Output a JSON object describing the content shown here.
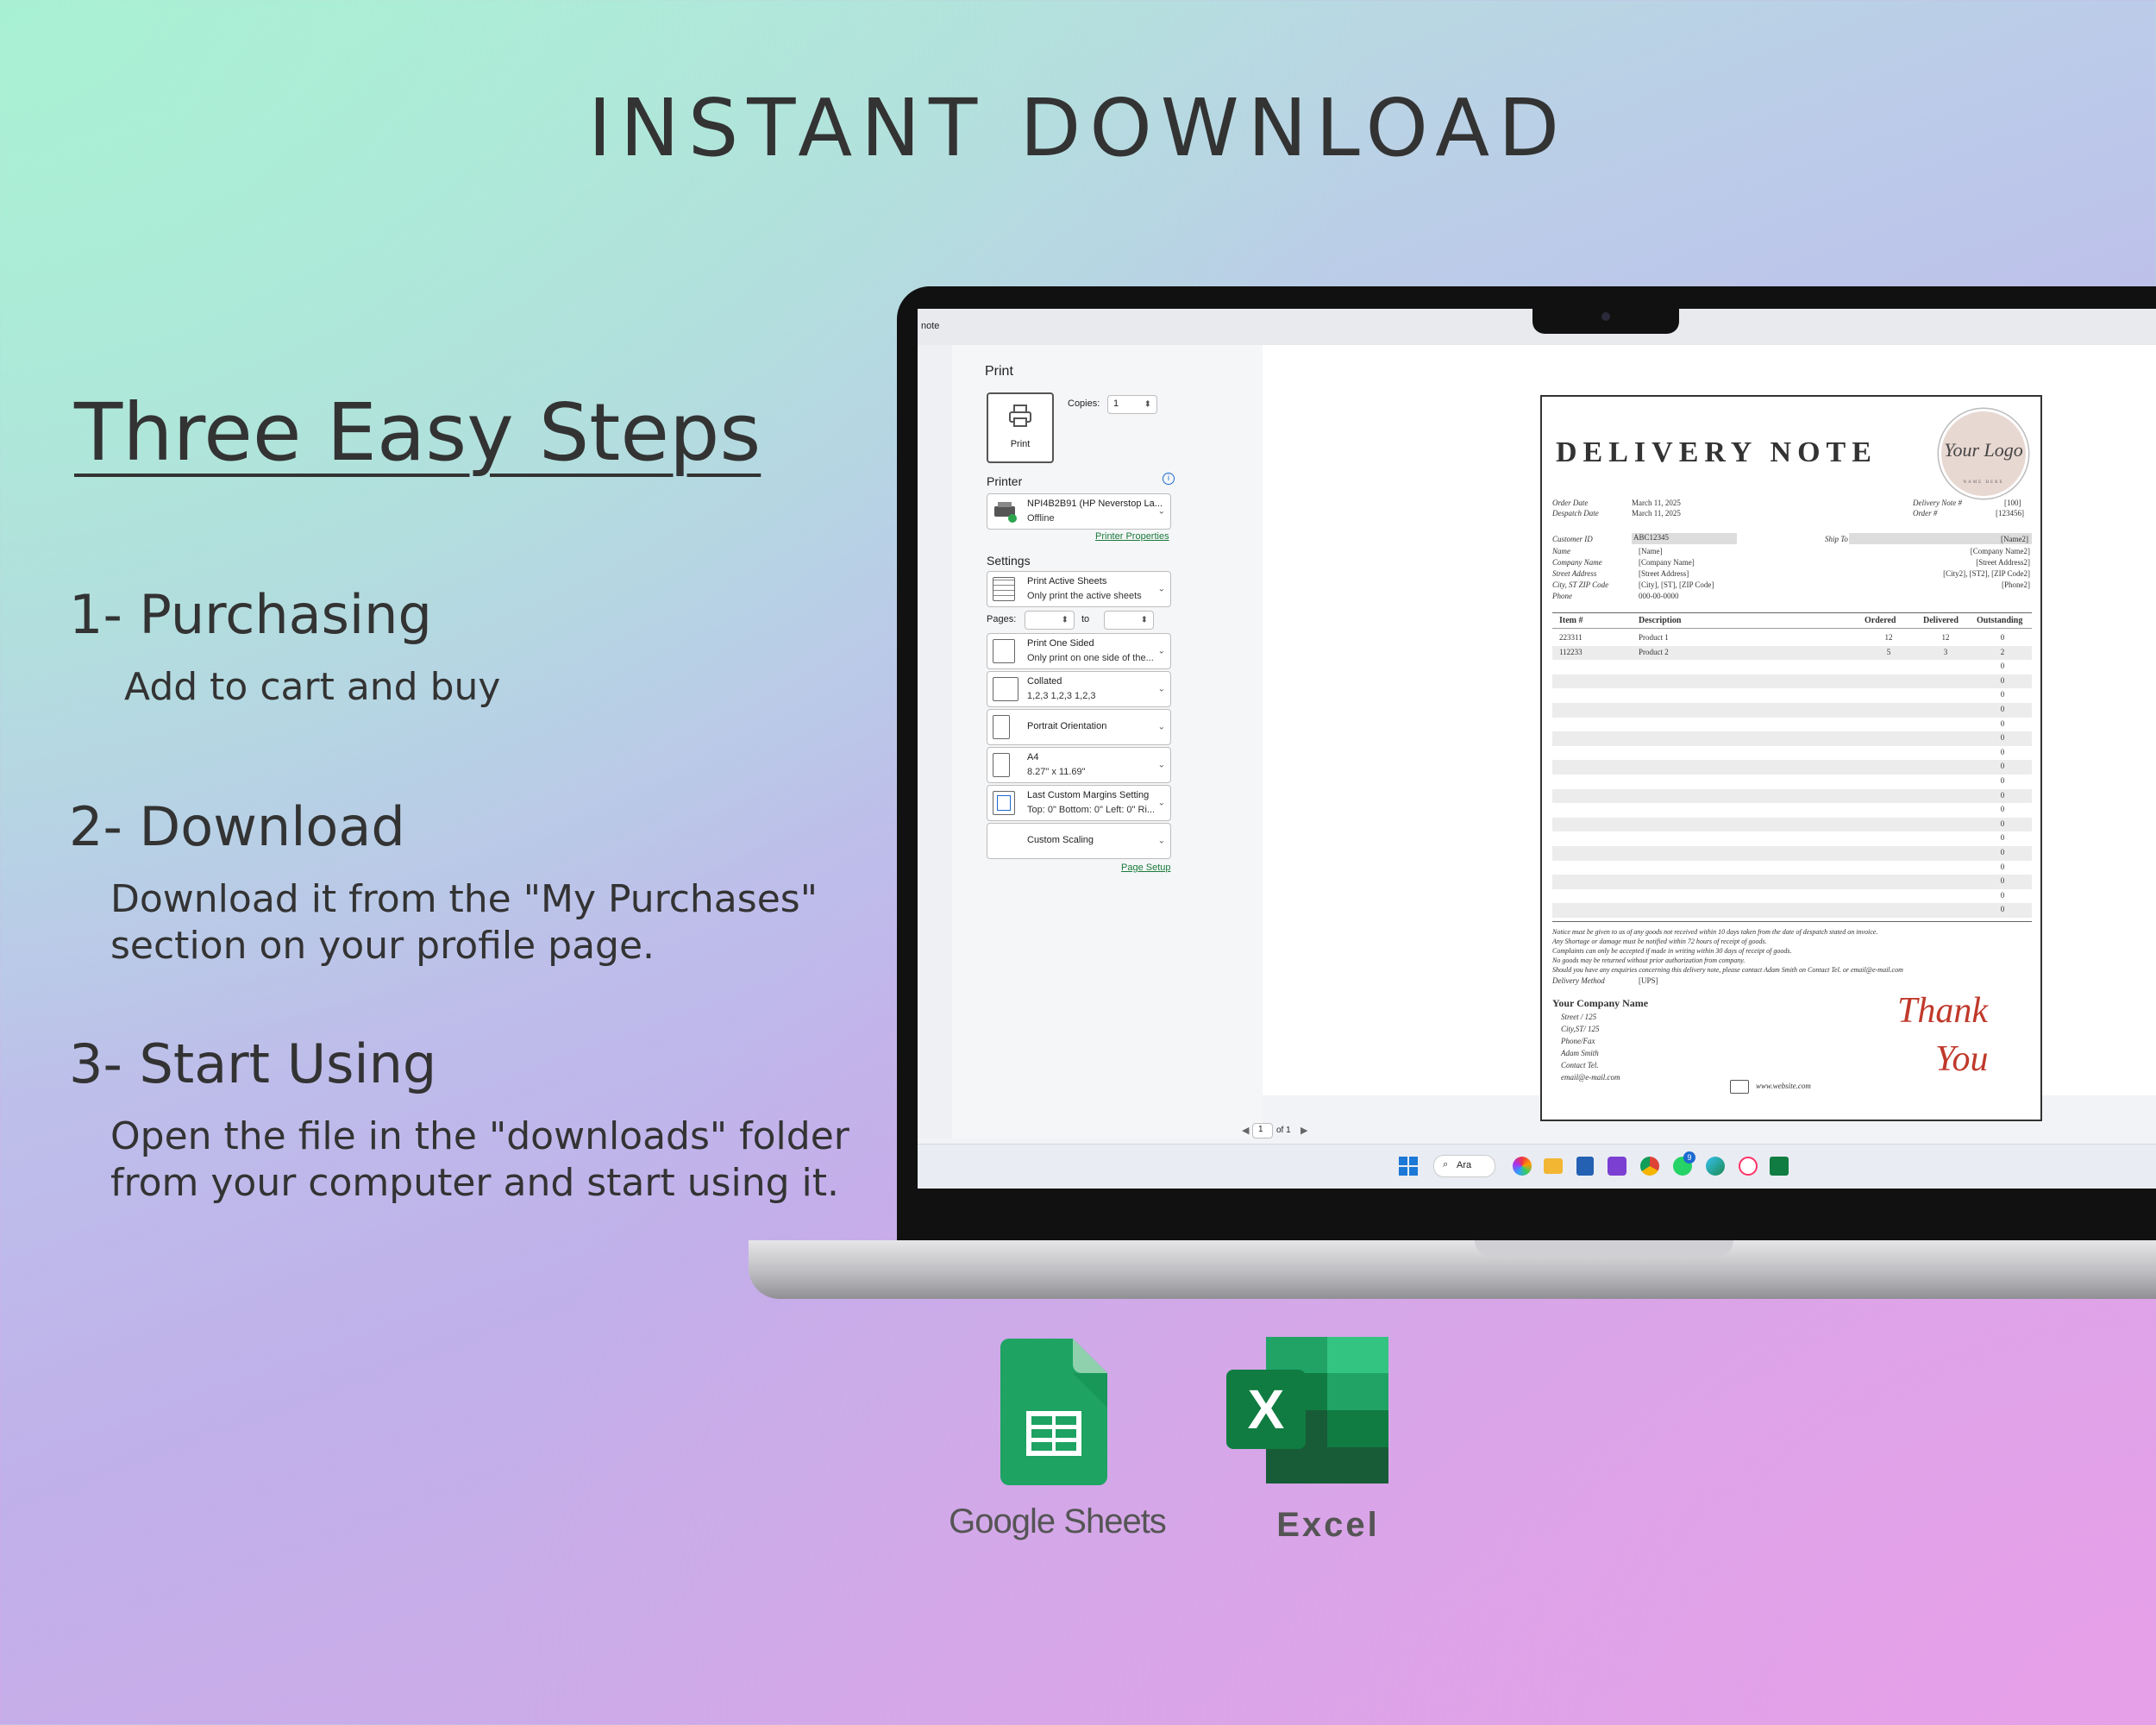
{
  "headline": "INSTANT DOWNLOAD",
  "steps": {
    "title": "Three Easy Steps",
    "items": [
      {
        "heading": "1- Purchasing",
        "lines": [
          "Add to cart and buy"
        ]
      },
      {
        "heading": "2- Download",
        "lines": [
          "Download it from the \"My Purchases\"",
          "section on your profile page."
        ]
      },
      {
        "heading": "3- Start Using",
        "lines": [
          "Open the file in the \"downloads\" folder",
          "from your computer and start using it."
        ]
      }
    ]
  },
  "print_dialog": {
    "window_title": "note",
    "title": "Print",
    "print_button": "Print",
    "copies_label": "Copies:",
    "copies_value": "1",
    "printer_label": "Printer",
    "printer_name": "NPI4B2B91 (HP Neverstop La...",
    "printer_status": "Offline",
    "printer_properties": "Printer Properties",
    "settings_label": "Settings",
    "settings": [
      {
        "line1": "Print Active Sheets",
        "line2": "Only print the active sheets"
      },
      {
        "line1": "Print One Sided",
        "line2": "Only print on one side of the..."
      },
      {
        "line1": "Collated",
        "line2": "1,2,3    1,2,3    1,2,3"
      },
      {
        "line1": "Portrait Orientation",
        "line2": ""
      },
      {
        "line1": "A4",
        "line2": "8.27\" x 11.69\""
      },
      {
        "line1": "Last Custom Margins Setting",
        "line2": "Top: 0\" Bottom: 0\" Left: 0\" Ri..."
      },
      {
        "line1": "Custom Scaling",
        "line2": ""
      }
    ],
    "pages_label": "Pages:",
    "pages_to": "to",
    "page_setup": "Page Setup",
    "page_current": "1",
    "page_of": "of 1"
  },
  "taskbar": {
    "search": "Ara",
    "notification_badge": "9"
  },
  "delivery_note": {
    "title": "DELIVERY NOTE",
    "logo_text": "Your Logo",
    "logo_subtext": "NAME HERE",
    "order_date_label": "Order Date",
    "order_date": "March 11, 2025",
    "dispatch_date_label": "Despatch Date",
    "dispatch_date": "March 11, 2025",
    "delivery_no_label": "Delivery Note #",
    "delivery_no": "[100]",
    "order_no_label": "Order #",
    "order_no": "[123456]",
    "customer_id_label": "Customer ID",
    "customer_id": "ABC12345",
    "ship_to_label": "Ship To",
    "bill_fields": [
      {
        "label": "Name",
        "value": "[Name]"
      },
      {
        "label": "Company Name",
        "value": "[Company Name]"
      },
      {
        "label": "Street Address",
        "value": "[Street Address]"
      },
      {
        "label": "City, ST ZIP Code",
        "value": "[City], [ST], [ZIP Code]"
      },
      {
        "label": "Phone",
        "value": "000-00-0000"
      }
    ],
    "ship_fields": [
      "[Name2]",
      "[Company Name2]",
      "[Street Address2]",
      "[City2], [ST2], [ZIP Code2]",
      "[Phone2]"
    ],
    "columns": [
      "Item #",
      "Description",
      "Ordered",
      "Delivered",
      "Outstanding"
    ],
    "rows": [
      {
        "item": "223311",
        "desc": "Product 1",
        "ordered": "12",
        "delivered": "12",
        "outstanding": "0"
      },
      {
        "item": "112233",
        "desc": "Product 2",
        "ordered": "5",
        "delivered": "3",
        "outstanding": "2"
      },
      {
        "item": "",
        "desc": "",
        "ordered": "",
        "delivered": "",
        "outstanding": "0"
      },
      {
        "item": "",
        "desc": "",
        "ordered": "",
        "delivered": "",
        "outstanding": "0"
      },
      {
        "item": "",
        "desc": "",
        "ordered": "",
        "delivered": "",
        "outstanding": "0"
      },
      {
        "item": "",
        "desc": "",
        "ordered": "",
        "delivered": "",
        "outstanding": "0"
      },
      {
        "item": "",
        "desc": "",
        "ordered": "",
        "delivered": "",
        "outstanding": "0"
      },
      {
        "item": "",
        "desc": "",
        "ordered": "",
        "delivered": "",
        "outstanding": "0"
      },
      {
        "item": "",
        "desc": "",
        "ordered": "",
        "delivered": "",
        "outstanding": "0"
      },
      {
        "item": "",
        "desc": "",
        "ordered": "",
        "delivered": "",
        "outstanding": "0"
      },
      {
        "item": "",
        "desc": "",
        "ordered": "",
        "delivered": "",
        "outstanding": "0"
      },
      {
        "item": "",
        "desc": "",
        "ordered": "",
        "delivered": "",
        "outstanding": "0"
      },
      {
        "item": "",
        "desc": "",
        "ordered": "",
        "delivered": "",
        "outstanding": "0"
      },
      {
        "item": "",
        "desc": "",
        "ordered": "",
        "delivered": "",
        "outstanding": "0"
      },
      {
        "item": "",
        "desc": "",
        "ordered": "",
        "delivered": "",
        "outstanding": "0"
      },
      {
        "item": "",
        "desc": "",
        "ordered": "",
        "delivered": "",
        "outstanding": "0"
      },
      {
        "item": "",
        "desc": "",
        "ordered": "",
        "delivered": "",
        "outstanding": "0"
      },
      {
        "item": "",
        "desc": "",
        "ordered": "",
        "delivered": "",
        "outstanding": "0"
      },
      {
        "item": "",
        "desc": "",
        "ordered": "",
        "delivered": "",
        "outstanding": "0"
      },
      {
        "item": "",
        "desc": "",
        "ordered": "",
        "delivered": "",
        "outstanding": "0"
      }
    ],
    "notes": [
      "Notice must be given to us of any goods not received within 10 days taken from the date of despatch stated on invoice.",
      "Any Shortage or damage must be notified within 72 hours of receipt of goods.",
      "Complaints can only be accepted if made in writing within 30 days of receipt of goods.",
      "No goods may be returned without prior authorization from company.",
      "Should you have any enquiries concerning this delivery note, please contact Adam Smith on Contact Tel. or email@e-mail.com"
    ],
    "delivery_method_label": "Delivery Method",
    "delivery_method": "[UPS]",
    "company_name": "Your Company Name",
    "company_lines": [
      "Street / 125",
      "City,ST/ 125",
      "Phone/Fax",
      "Adam Smith",
      "Contact Tel.",
      "email@e-mail.com"
    ],
    "thank": "Thank",
    "you": "You",
    "website": "www.website.com"
  },
  "apps": {
    "sheets_label": "Google Sheets",
    "excel_label": "Excel",
    "excel_letter": "X"
  },
  "colors": {
    "sheets_green": "#1ea362",
    "excel_dark": "#107c41",
    "accent_red": "#c0392b"
  }
}
